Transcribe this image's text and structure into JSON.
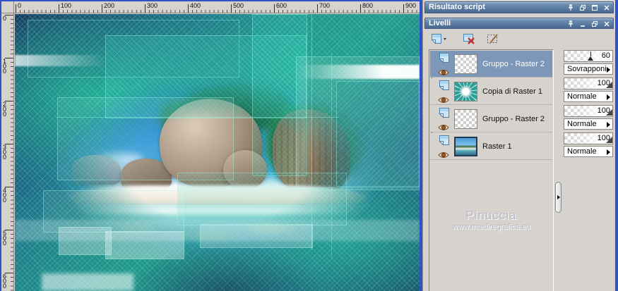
{
  "rulers": {
    "top": [
      "0",
      "100",
      "200",
      "300",
      "400",
      "500",
      "600",
      "700",
      "800",
      "900"
    ],
    "left": [
      "0",
      "100",
      "200",
      "300",
      "400",
      "500",
      "600"
    ]
  },
  "script_panel": {
    "title": "Risultato script"
  },
  "layers_panel": {
    "title": "Livelli",
    "toolbar_icons": [
      "new-layer-icon",
      "delete-layer-icon",
      "edit-selection-icon"
    ],
    "layers": [
      {
        "name": "Gruppo - Raster 2",
        "opacity": "60",
        "blend": "Sovrapponi",
        "selected": true,
        "thumb": "transparent-checker"
      },
      {
        "name": "Copia di Raster 1",
        "opacity": "100",
        "blend": "Normale",
        "selected": false,
        "thumb": "teal-pattern"
      },
      {
        "name": "Gruppo - Raster 2",
        "opacity": "100",
        "blend": "Normale",
        "selected": false,
        "thumb": "transparent-checker"
      },
      {
        "name": "Raster 1",
        "opacity": "100",
        "blend": "Normale",
        "selected": false,
        "thumb": "beach-photo"
      }
    ]
  },
  "watermark": {
    "name": "Pinuccia",
    "url": "www.maidiregrafica.eu"
  },
  "colors": {
    "window_border": "#2e53c8",
    "panel_bg": "#d6d3ce",
    "titlebar": "#5d7fa6",
    "selected_row": "#7d97b9",
    "canvas_teal": "#23968c",
    "canvas_navy": "#14365c"
  }
}
